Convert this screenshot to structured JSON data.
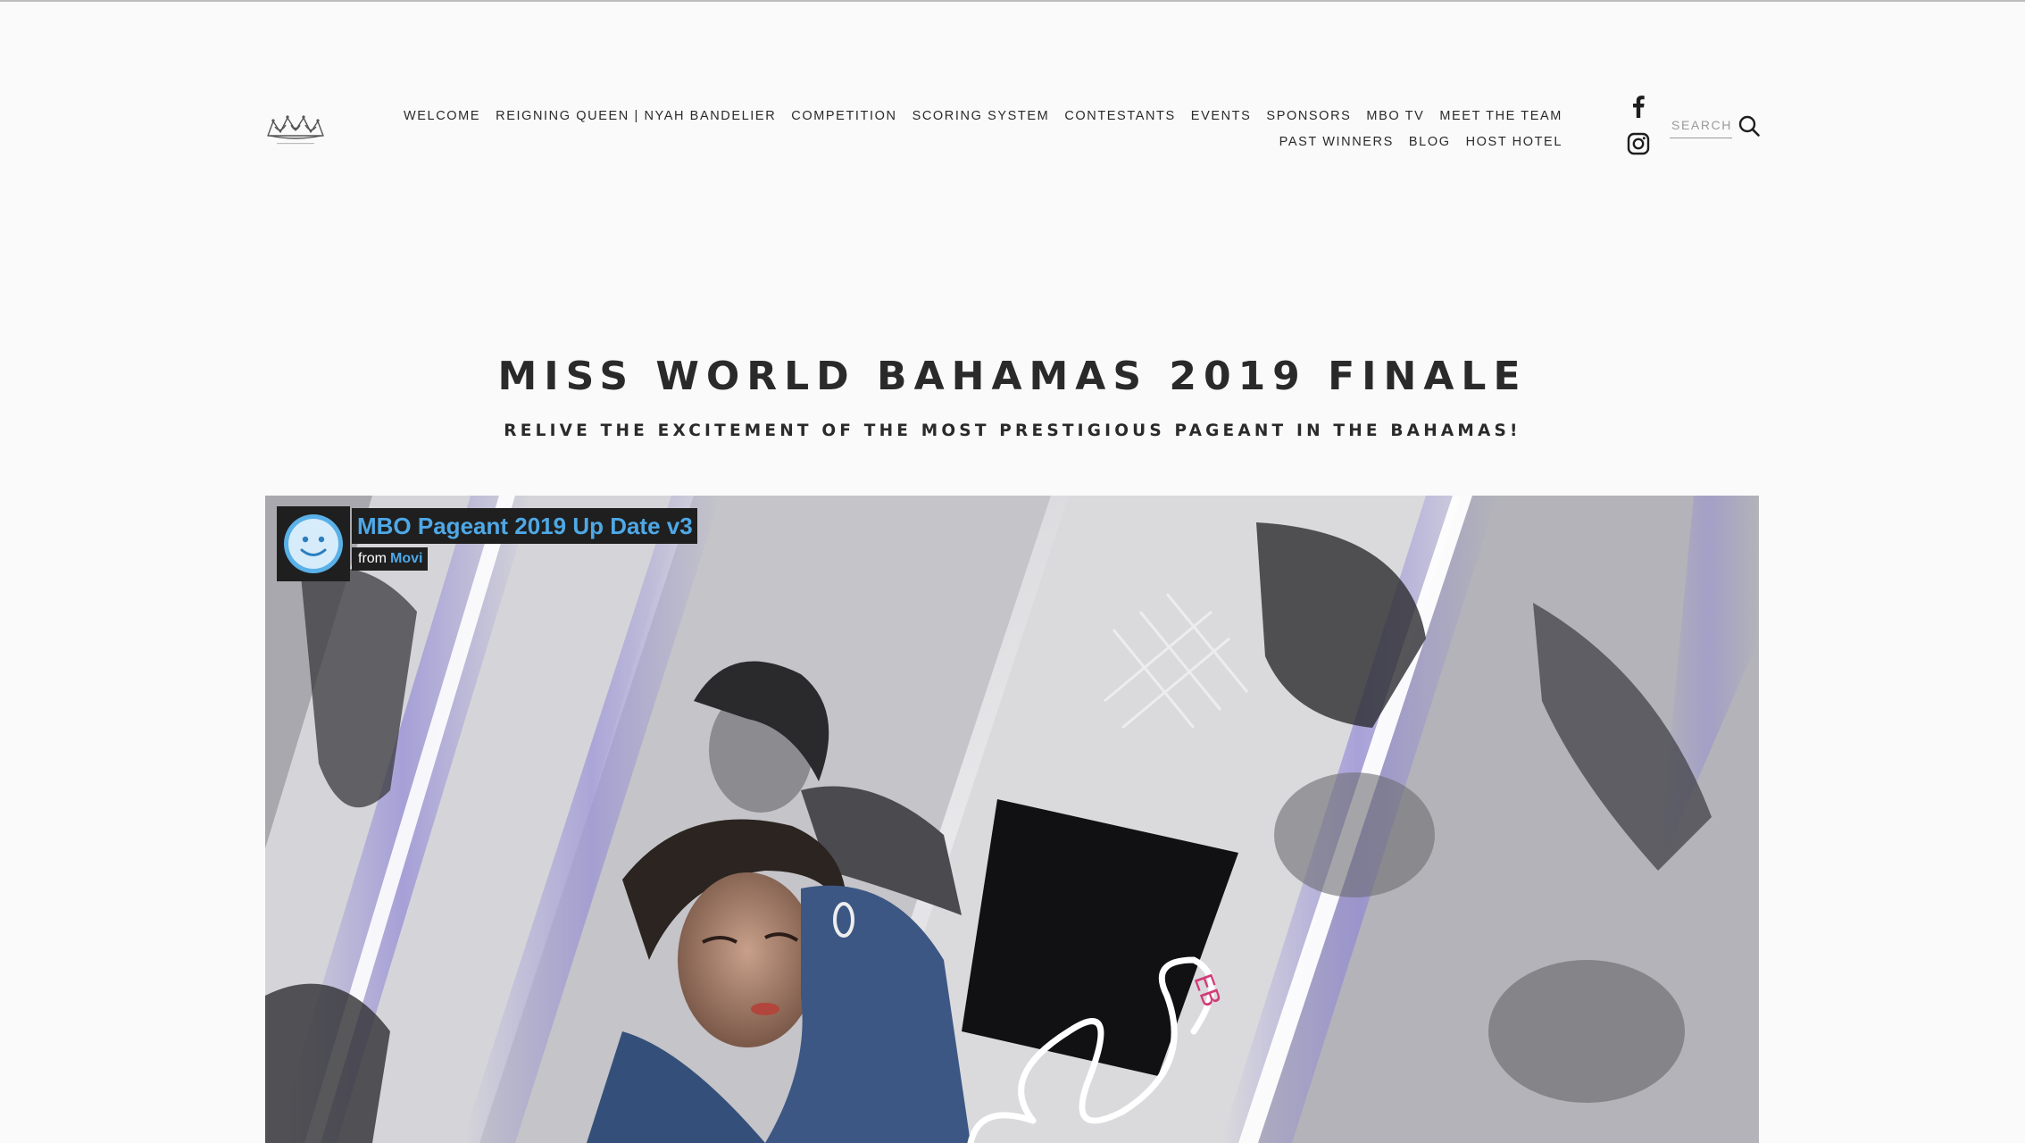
{
  "header": {
    "logo_icon": "crown-logo-icon",
    "nav_items": [
      {
        "label": "WELCOME"
      },
      {
        "label": "REIGNING QUEEN | NYAH BANDELIER"
      },
      {
        "label": "COMPETITION"
      },
      {
        "label": "SCORING SYSTEM"
      },
      {
        "label": "CONTESTANTS"
      },
      {
        "label": "EVENTS"
      },
      {
        "label": "SPONSORS"
      },
      {
        "label": "MBO TV"
      },
      {
        "label": "MEET THE TEAM"
      },
      {
        "label": "PAST WINNERS"
      },
      {
        "label": "BLOG"
      },
      {
        "label": "HOST HOTEL"
      }
    ],
    "social": [
      {
        "icon": "facebook-icon"
      },
      {
        "icon": "instagram-icon"
      }
    ],
    "search": {
      "placeholder": "SEARCH",
      "icon": "search-icon"
    }
  },
  "hero": {
    "title": "MISS WORLD BAHAMAS 2019 FINALE",
    "subtitle": "RELIVE THE EXCITEMENT OF THE MOST PRESTIGIOUS PAGEANT IN THE BAHAMAS!"
  },
  "video": {
    "title": "MBO Pageant 2019 Up Date v3",
    "byline_prefix": "from",
    "author": "Movi",
    "avatar_icon": "smiley-avatar-icon",
    "title_color": "#4ea8e6"
  },
  "colors": {
    "background": "#fafafa",
    "text": "#2a2a2a",
    "accent_blue": "#4ea8e6"
  }
}
